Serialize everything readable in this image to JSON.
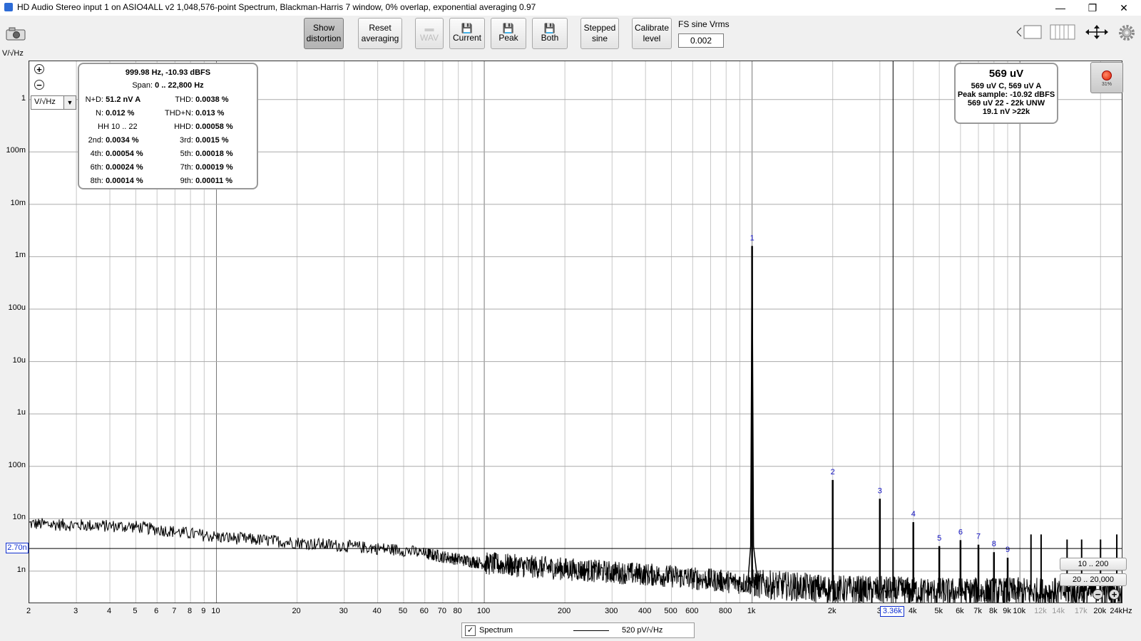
{
  "window": {
    "title": "HD Audio Stereo input 1 on ASIO4ALL v2 1,048,576-point Spectrum, Blackman-Harris 7 window, 0% overlap, exponential averaging 0.97",
    "minimize": "—",
    "restore": "❐",
    "close": "✕"
  },
  "toolbar": {
    "show_distortion": [
      "Show",
      "distortion"
    ],
    "reset_averaging": [
      "Reset",
      "averaging"
    ],
    "wav": "WAV",
    "current": "Current",
    "peak": "Peak",
    "both": "Both",
    "stepped_sine": [
      "Stepped",
      "sine"
    ],
    "calibrate_level": [
      "Calibrate",
      "level"
    ],
    "fs_label": "FS sine Vrms",
    "fs_value": "0.002"
  },
  "axes": {
    "y_unit": "V/√Hz",
    "unit_select": "V/√Hz",
    "y_ticks": [
      {
        "label": "1",
        "exp": 0
      },
      {
        "label": "100m",
        "exp": -1
      },
      {
        "label": "10m",
        "exp": -2
      },
      {
        "label": "1m",
        "exp": -3
      },
      {
        "label": "100u",
        "exp": -4
      },
      {
        "label": "10u",
        "exp": -5
      },
      {
        "label": "1u",
        "exp": -6
      },
      {
        "label": "100n",
        "exp": -7
      },
      {
        "label": "10n",
        "exp": -8
      },
      {
        "label": "1n",
        "exp": -9
      }
    ],
    "y_range_exp": [
      -9.6,
      0.73
    ],
    "x_range_hz": [
      2,
      24000
    ],
    "x_ticks": [
      {
        "label": "2",
        "f": 2
      },
      {
        "label": "3",
        "f": 3
      },
      {
        "label": "4",
        "f": 4
      },
      {
        "label": "5",
        "f": 5
      },
      {
        "label": "6",
        "f": 6
      },
      {
        "label": "7",
        "f": 7
      },
      {
        "label": "8",
        "f": 8
      },
      {
        "label": "9",
        "f": 9
      },
      {
        "label": "10",
        "f": 10
      },
      {
        "label": "20",
        "f": 20
      },
      {
        "label": "30",
        "f": 30
      },
      {
        "label": "40",
        "f": 40
      },
      {
        "label": "50",
        "f": 50
      },
      {
        "label": "60",
        "f": 60
      },
      {
        "label": "70",
        "f": 70
      },
      {
        "label": "80",
        "f": 80
      },
      {
        "label": "100",
        "f": 100
      },
      {
        "label": "200",
        "f": 200
      },
      {
        "label": "300",
        "f": 300
      },
      {
        "label": "400",
        "f": 400
      },
      {
        "label": "500",
        "f": 500
      },
      {
        "label": "600",
        "f": 600
      },
      {
        "label": "800",
        "f": 800
      },
      {
        "label": "1k",
        "f": 1000
      },
      {
        "label": "2k",
        "f": 2000
      },
      {
        "label": "3",
        "f": 3000
      },
      {
        "label": "4k",
        "f": 4000
      },
      {
        "label": "5k",
        "f": 5000
      },
      {
        "label": "6k",
        "f": 6000
      },
      {
        "label": "7k",
        "f": 7000
      },
      {
        "label": "8k",
        "f": 8000
      },
      {
        "label": "9k",
        "f": 9000
      },
      {
        "label": "10k",
        "f": 10000
      },
      {
        "label": "12k",
        "f": 12000
      },
      {
        "label": "14k",
        "f": 14000
      },
      {
        "label": "17k",
        "f": 17000
      },
      {
        "label": "20k",
        "f": 20000
      },
      {
        "label": "24kHz",
        "f": 24000
      }
    ],
    "y_marker_label": "2.70n",
    "y_marker_value": 2.7e-09,
    "x_marker_label": "3.36k",
    "x_marker_hz": 3360
  },
  "distortion": {
    "header": "999.98 Hz, -10.93 dBFS",
    "span_label": "Span:",
    "span_value": "0 .. 22,800 Hz",
    "hh_label": "HH 10 .. 22",
    "rows": [
      {
        "k1": "N+D:",
        "v1": "51.2 nV A",
        "k2": "THD:",
        "v2": "0.0038 %"
      },
      {
        "k1": "N:",
        "v1": "0.012 %",
        "k2": "THD+N:",
        "v2": "0.013 %"
      },
      {
        "k1": "",
        "v1": "",
        "k2": "HHD:",
        "v2": "0.00058 %"
      },
      {
        "k1": "2nd:",
        "v1": "0.0034 %",
        "k2": "3rd:",
        "v2": "0.0015 %"
      },
      {
        "k1": "4th:",
        "v1": "0.00054 %",
        "k2": "5th:",
        "v2": "0.00018 %"
      },
      {
        "k1": "6th:",
        "v1": "0.00024 %",
        "k2": "7th:",
        "v2": "0.00019 %"
      },
      {
        "k1": "8th:",
        "v1": "0.00014 %",
        "k2": "9th:",
        "v2": "0.00011 %"
      }
    ]
  },
  "level": {
    "main": "569 uV",
    "line1": "569 uV C, 569 uV A",
    "line2": "Peak sample: -10.92 dBFS",
    "line3": "569 uV 22 - 22k UNW",
    "line4": "19.1 nV >22k"
  },
  "record": {
    "percent": "31%"
  },
  "range_buttons": {
    "a": "10 .. 200",
    "b": "20 .. 20,000"
  },
  "legend": {
    "check": "✓",
    "name": "Spectrum",
    "value": "520 pV/√Hz"
  },
  "chart_data": {
    "type": "line",
    "title": "",
    "xlabel": "",
    "ylabel": "V/√Hz",
    "x_scale": "log",
    "y_scale": "log",
    "xlim": [
      2,
      24000
    ],
    "ylim": [
      2.5e-10,
      5.4
    ],
    "series": [
      {
        "name": "Spectrum",
        "color": "#000000",
        "noise_floor": {
          "x": [
            2,
            5,
            10,
            20,
            50,
            100,
            200,
            500,
            900,
            2000,
            5000,
            10000,
            20000,
            24000
          ],
          "y": [
            8e-09,
            7e-09,
            4.5e-09,
            3.5e-09,
            2.5e-09,
            1.4e-09,
            1.1e-09,
            8e-10,
            6e-10,
            4.5e-10,
            4e-10,
            4e-10,
            4e-10,
            4e-10
          ]
        },
        "harmonics": [
          {
            "label": "1",
            "hz": 1000,
            "v": 0.0016
          },
          {
            "label": "2",
            "hz": 2000,
            "v": 5.5e-08
          },
          {
            "label": "3",
            "hz": 3000,
            "v": 2.4e-08
          },
          {
            "label": "4",
            "hz": 4000,
            "v": 8.6e-09
          },
          {
            "label": "5",
            "hz": 5000,
            "v": 3e-09
          },
          {
            "label": "6",
            "hz": 6000,
            "v": 3.9e-09
          },
          {
            "label": "7",
            "hz": 7000,
            "v": 3.2e-09
          },
          {
            "label": "8",
            "hz": 8000,
            "v": 2.3e-09
          },
          {
            "label": "9",
            "hz": 9000,
            "v": 1.8e-09
          }
        ],
        "extra_spurs": [
          {
            "hz": 3360,
            "v": 2.7e-09
          },
          {
            "hz": 11000,
            "v": 5e-09
          },
          {
            "hz": 12000,
            "v": 5e-09
          },
          {
            "hz": 15000,
            "v": 4e-09
          },
          {
            "hz": 17000,
            "v": 4e-09
          },
          {
            "hz": 20000,
            "v": 4e-09
          },
          {
            "hz": 23000,
            "v": 5e-09
          }
        ]
      }
    ]
  }
}
